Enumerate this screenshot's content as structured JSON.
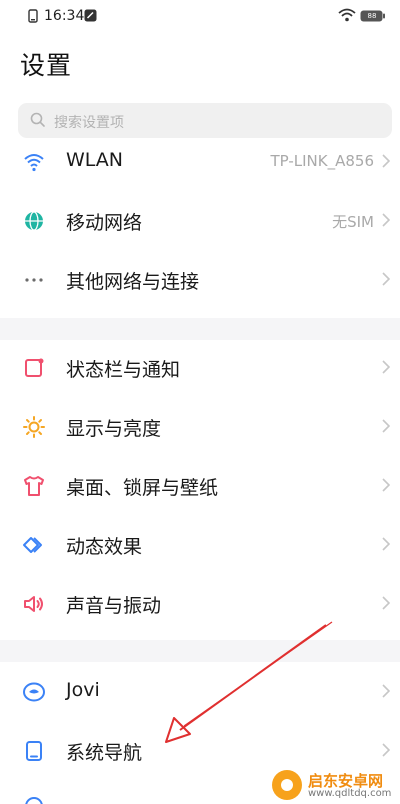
{
  "status_bar": {
    "time": "16:34",
    "battery": "88"
  },
  "page": {
    "title": "设置"
  },
  "search": {
    "placeholder": "搜索设置项"
  },
  "settings": [
    {
      "id": "wlan",
      "label": "WLAN",
      "value": "TP-LINK_A856",
      "icon": "wifi-icon",
      "icon_color": "#3b82f6"
    },
    {
      "id": "mobile-network",
      "label": "移动网络",
      "value": "无SIM",
      "icon": "globe-icon",
      "icon_color": "#1fb5a3"
    },
    {
      "id": "other-network",
      "label": "其他网络与连接",
      "value": "",
      "icon": "more-dots-icon",
      "icon_color": "#6b6b6b"
    },
    {
      "id": "status-bar",
      "label": "状态栏与通知",
      "value": "",
      "icon": "notification-icon",
      "icon_color": "#f0506e"
    },
    {
      "id": "display",
      "label": "显示与亮度",
      "value": "",
      "icon": "sun-icon",
      "icon_color": "#f5a623"
    },
    {
      "id": "desktop",
      "label": "桌面、锁屏与壁纸",
      "value": "",
      "icon": "tshirt-icon",
      "icon_color": "#f0506e"
    },
    {
      "id": "animation",
      "label": "动态效果",
      "value": "",
      "icon": "diamond-icon",
      "icon_color": "#3b82f6"
    },
    {
      "id": "sound",
      "label": "声音与振动",
      "value": "",
      "icon": "speaker-icon",
      "icon_color": "#f0506e"
    },
    {
      "id": "jovi",
      "label": "Jovi",
      "value": "",
      "icon": "jovi-icon",
      "icon_color": "#3b82f6"
    },
    {
      "id": "system-nav",
      "label": "系统导航",
      "value": "",
      "icon": "tablet-icon",
      "icon_color": "#3b82f6"
    }
  ],
  "watermark": {
    "title": "启东安卓网",
    "url": "www.qdltdq.com"
  },
  "colors": {
    "annotation_arrow": "#e03030",
    "chevron": "#c7c7c7"
  }
}
